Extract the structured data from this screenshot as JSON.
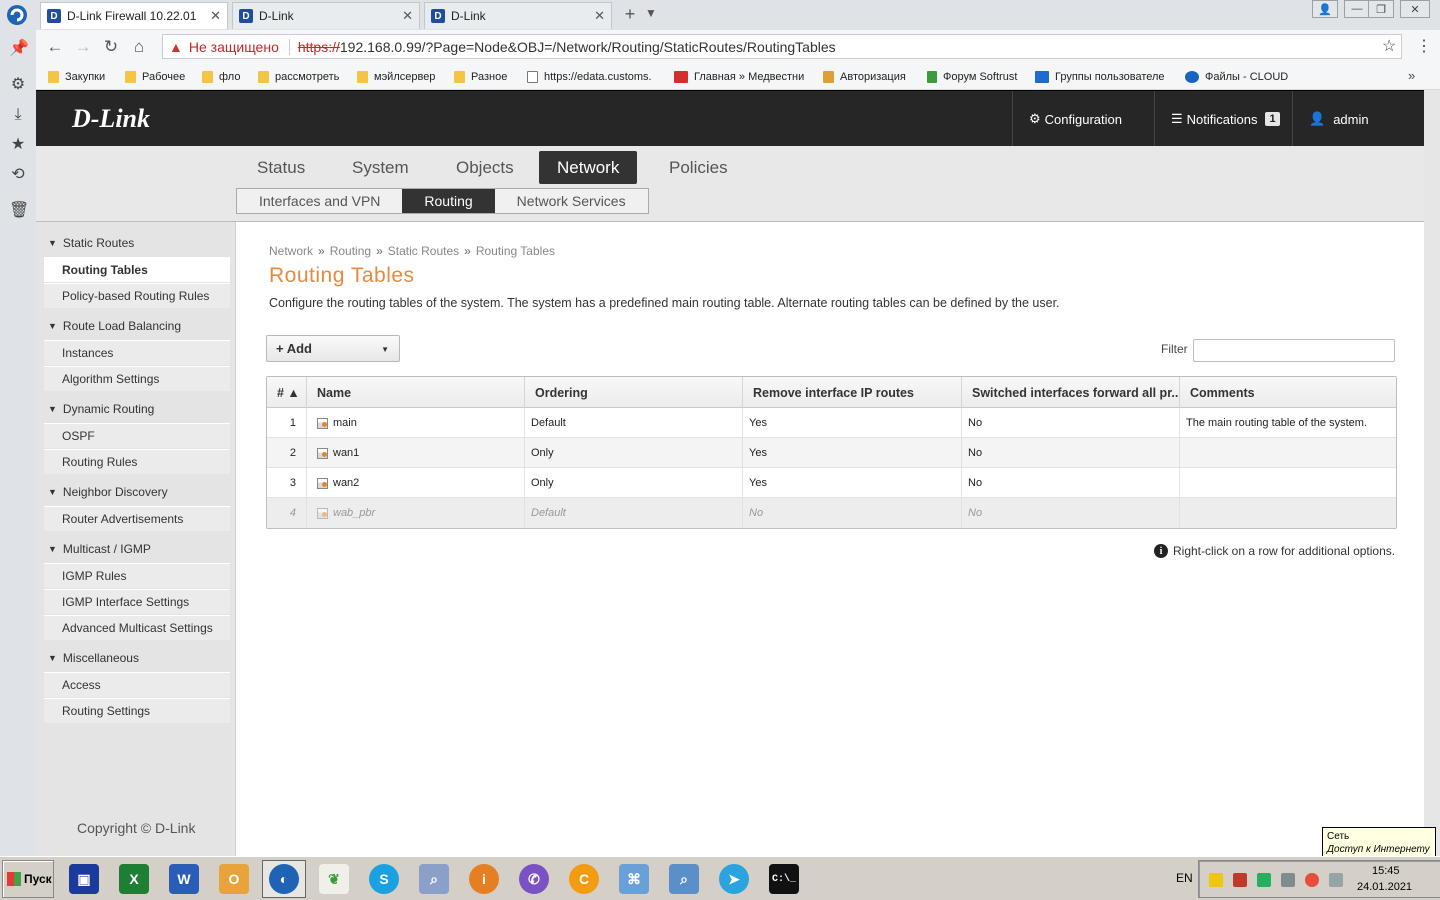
{
  "browser": {
    "tabs": [
      {
        "title": "D-Link Firewall 10.22.01",
        "active": true
      },
      {
        "title": "D-Link",
        "active": false
      },
      {
        "title": "D-Link",
        "active": false
      }
    ],
    "address": {
      "security_warning": "Не защищено",
      "scheme": "https://",
      "url_rest": "192.168.0.99/?Page=Node&OBJ=/Network/Routing/StaticRoutes/RoutingTables"
    },
    "bookmarks": [
      {
        "label": "Закупки",
        "icon": "folder-icon"
      },
      {
        "label": "Рабочее",
        "icon": "folder-icon"
      },
      {
        "label": "фло",
        "icon": "folder-icon"
      },
      {
        "label": "рассмотреть",
        "icon": "folder-icon"
      },
      {
        "label": "мэйлсервер",
        "icon": "folder-icon"
      },
      {
        "label": "Разное",
        "icon": "folder-icon"
      },
      {
        "label": "https://edata.customs.",
        "icon": "page-icon"
      },
      {
        "label": "Главная » Медвестни",
        "icon": "mv-icon"
      },
      {
        "label": "Авторизация",
        "icon": "list-icon"
      },
      {
        "label": "Форум Softrust",
        "icon": "leaf-icon"
      },
      {
        "label": "Группы пользователе",
        "icon": "puzzle-icon"
      },
      {
        "label": "Файлы - CLOUD",
        "icon": "cloud-icon"
      }
    ]
  },
  "header": {
    "logo": "D-Link",
    "configuration": "Configuration",
    "notifications": "Notifications",
    "notifications_count": "1",
    "user": "admin"
  },
  "main_nav": [
    "Status",
    "System",
    "Objects",
    "Network",
    "Policies"
  ],
  "main_nav_active": "Network",
  "sub_nav": [
    "Interfaces and VPN",
    "Routing",
    "Network Services"
  ],
  "sub_nav_active": "Routing",
  "sidebar": {
    "groups": [
      {
        "label": "Static Routes",
        "items": [
          "Routing Tables",
          "Policy-based Routing Rules"
        ]
      },
      {
        "label": "Route Load Balancing",
        "items": [
          "Instances",
          "Algorithm Settings"
        ]
      },
      {
        "label": "Dynamic Routing",
        "items": [
          "OSPF",
          "Routing Rules"
        ]
      },
      {
        "label": "Neighbor Discovery",
        "items": [
          "Router Advertisements"
        ]
      },
      {
        "label": "Multicast / IGMP",
        "items": [
          "IGMP Rules",
          "IGMP Interface Settings",
          "Advanced Multicast Settings"
        ]
      },
      {
        "label": "Miscellaneous",
        "items": [
          "Access",
          "Routing Settings"
        ]
      }
    ],
    "active_item": "Routing Tables",
    "copyright": "Copyright © D-Link"
  },
  "content": {
    "breadcrumb": [
      "Network",
      "Routing",
      "Static Routes",
      "Routing Tables"
    ],
    "breadcrumb_sep": "»",
    "title": "Routing Tables",
    "description": "Configure the routing tables of the system. The system has a predefined main routing table. Alternate routing tables can be defined by the user.",
    "add_button": "+ Add",
    "filter_label": "Filter",
    "filter_value": "",
    "columns": [
      "# ▲",
      "Name",
      "Ordering",
      "Remove interface IP routes",
      "Switched interfaces forward all pr...",
      "Comments"
    ],
    "rows": [
      {
        "num": "1",
        "name": "main",
        "ordering": "Default",
        "remove_ip_routes": "Yes",
        "switched_forward": "No",
        "comments": "The main routing table of the system.",
        "disabled": false
      },
      {
        "num": "2",
        "name": "wan1",
        "ordering": "Only",
        "remove_ip_routes": "Yes",
        "switched_forward": "No",
        "comments": "",
        "disabled": false
      },
      {
        "num": "3",
        "name": "wan2",
        "ordering": "Only",
        "remove_ip_routes": "Yes",
        "switched_forward": "No",
        "comments": "",
        "disabled": false
      },
      {
        "num": "4",
        "name": "wab_pbr",
        "ordering": "Default",
        "remove_ip_routes": "No",
        "switched_forward": "No",
        "comments": "",
        "disabled": true
      }
    ],
    "hint": "Right-click on a row for additional options."
  },
  "taskbar": {
    "start": "Пуск",
    "lang": "EN",
    "time": "15:45",
    "date": "24.01.2021",
    "tooltip_title": "Сеть",
    "tooltip_text": "Доступ к Интернету"
  },
  "colors": {
    "accent_orange": "#e8893f",
    "header_bg": "#262626",
    "nav_active": "#333333"
  }
}
